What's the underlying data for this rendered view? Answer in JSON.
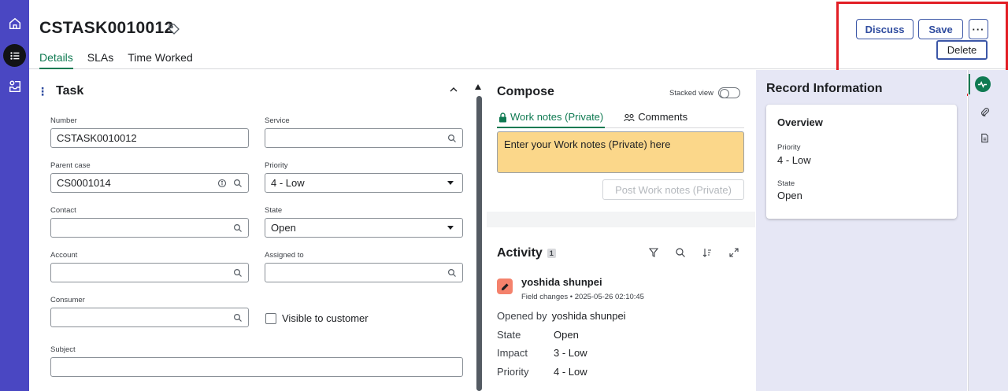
{
  "header": {
    "record_number": "CSTASK0010012",
    "tabs": [
      "Details",
      "SLAs",
      "Time Worked"
    ],
    "discuss_label": "Discuss",
    "save_label": "Save",
    "more_label": "···",
    "delete_label": "Delete"
  },
  "task": {
    "section_title": "Task",
    "number_label": "Number",
    "number_value": "CSTASK0010012",
    "service_label": "Service",
    "service_value": "",
    "parent_label": "Parent case",
    "parent_value": "CS0001014",
    "priority_label": "Priority",
    "priority_value": "4 - Low",
    "contact_label": "Contact",
    "contact_value": "",
    "state_label": "State",
    "state_value": "Open",
    "account_label": "Account",
    "account_value": "",
    "assigned_label": "Assigned to",
    "assigned_value": "",
    "consumer_label": "Consumer",
    "consumer_value": "",
    "visible_label": "Visible to customer",
    "subject_label": "Subject",
    "subject_value": ""
  },
  "compose": {
    "title": "Compose",
    "stacked_label": "Stacked view",
    "tab_work_notes": "Work notes (Private)",
    "tab_comments": "Comments",
    "placeholder": "Enter your Work notes (Private) here",
    "post_label": "Post Work notes (Private)"
  },
  "activity": {
    "title": "Activity",
    "count": "1",
    "user": "yoshida shunpei",
    "meta": "Field changes • 2025-05-26 02:10:45",
    "rows": [
      {
        "key": "Opened by",
        "value": "yoshida shunpei"
      },
      {
        "key": "State",
        "value": "Open"
      },
      {
        "key": "Impact",
        "value": "3 - Low"
      },
      {
        "key": "Priority",
        "value": "4 - Low"
      }
    ]
  },
  "record": {
    "title": "Record Information",
    "overview": "Overview",
    "priority_label": "Priority",
    "priority_value": "4 - Low",
    "state_label": "State",
    "state_value": "Open"
  },
  "colors": {
    "rail": "#4a47c2",
    "accent_green": "#0f7a52",
    "button_blue": "#2f4c9f",
    "work_notes_bg": "#fbd78a",
    "highlight_red": "#e21e25",
    "panel_lavender": "#e6e7f5"
  },
  "icons": [
    "home-icon",
    "list-icon",
    "inbox-icon",
    "tag-icon",
    "search-icon",
    "info-icon",
    "lock-icon",
    "people-icon",
    "filter-icon",
    "sort-icon",
    "expand-icon",
    "pencil-icon",
    "pulse-icon",
    "paperclip-icon",
    "document-icon"
  ]
}
